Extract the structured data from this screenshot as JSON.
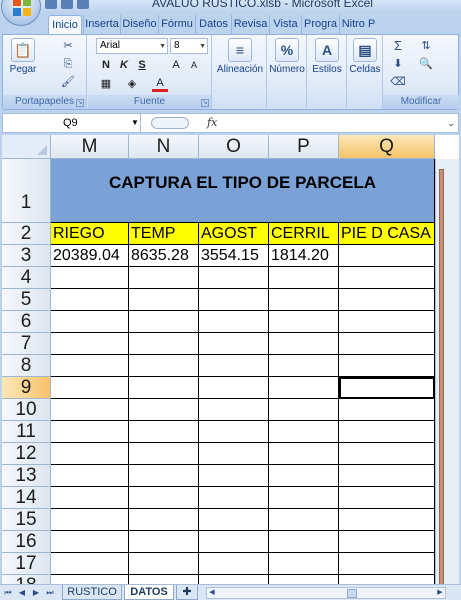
{
  "window": {
    "title": "AVALUO RUSTICO.xlsb - Microsoft Excel"
  },
  "ribbon": {
    "tabs": [
      "Inicio",
      "Inserta",
      "Diseño",
      "Fórmu",
      "Datos",
      "Revisa",
      "Vista",
      "Progra",
      "Nitro P"
    ],
    "active_tab": "Inicio",
    "groups": {
      "portapapeles": {
        "label": "Portapapeles",
        "paste_label": "Pegar"
      },
      "fuente": {
        "label": "Fuente",
        "font_name": "Arial",
        "font_size": "8",
        "bold": "N",
        "italic": "K",
        "underline": "S",
        "grow": "A",
        "shrink": "A",
        "font_color_letter": "A",
        "font_color": "#e02020"
      },
      "alineacion": {
        "label": "Alineación"
      },
      "numero": {
        "label": "Número",
        "glyph": "%"
      },
      "estilos": {
        "label": "Estilos"
      },
      "celdas": {
        "label": "Celdas"
      },
      "modificar": {
        "label": "Modificar",
        "sum": "Σ"
      }
    }
  },
  "formula_bar": {
    "name_box": "Q9",
    "fx": "fx",
    "content": ""
  },
  "grid": {
    "columns": [
      "M",
      "N",
      "O",
      "P",
      "Q"
    ],
    "selected_column": "Q",
    "rows": [
      "1",
      "2",
      "3",
      "4",
      "5",
      "6",
      "7",
      "8",
      "9",
      "10",
      "11",
      "12",
      "13",
      "14",
      "15",
      "16",
      "17",
      "18"
    ],
    "selected_row": "9",
    "title": "CAPTURA EL TIPO DE PARCELA",
    "header_row": [
      "RIEGO",
      "TEMP",
      "AGOST",
      "CERRIL",
      "PIE D CASA"
    ],
    "value_row": [
      "20389.04",
      "8635.28",
      "3554.15",
      "1814.20",
      ""
    ],
    "active_cell": "Q9",
    "colors": {
      "title_band": "#7aa2d6",
      "header_fill": "#ffff00",
      "selection_header": "#f7c26a"
    }
  },
  "sheets": {
    "tabs": [
      "RUSTICO",
      "DATOS"
    ],
    "active": "DATOS"
  }
}
